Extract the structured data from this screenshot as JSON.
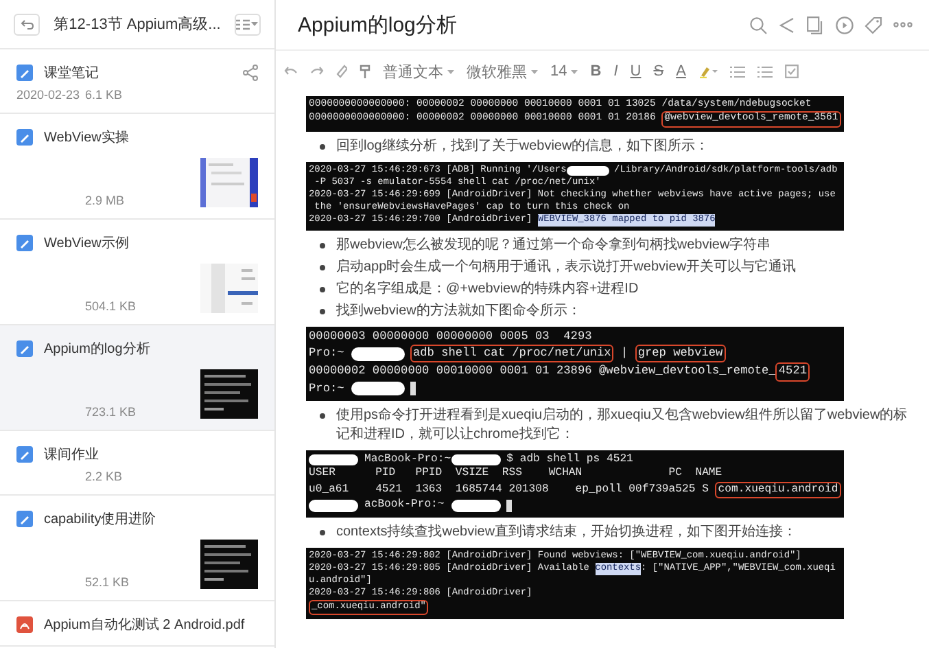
{
  "sidebar": {
    "title": "第12-13节 Appium高级...",
    "notes": [
      {
        "kind": "note",
        "title": "课堂笔记",
        "date": "2020-02-23",
        "size": "6.1 KB",
        "shared": true,
        "selected": false
      },
      {
        "kind": "note",
        "title": "WebView实操",
        "size": "2.9 MB",
        "shared": false,
        "thumbnail": {
          "kind": "light"
        },
        "selected": false
      },
      {
        "kind": "note",
        "title": "WebView示例",
        "size": "504.1 KB",
        "shared": false,
        "thumbnail": {
          "kind": "list"
        },
        "selected": false
      },
      {
        "kind": "note",
        "title": "Appium的log分析",
        "size": "723.1 KB",
        "shared": false,
        "thumbnail": {
          "kind": "dark"
        },
        "selected": true
      },
      {
        "kind": "note",
        "title": "课间作业",
        "size": "2.2 KB",
        "shared": false,
        "selected": false
      },
      {
        "kind": "note",
        "title": "capability使用进阶",
        "size": "52.1 KB",
        "shared": false,
        "thumbnail": {
          "kind": "dark"
        },
        "selected": false
      },
      {
        "kind": "pdf",
        "title": "Appium自动化测试 2 Android.pdf",
        "shared": false,
        "selected": false
      }
    ]
  },
  "editor": {
    "title": "Appium的log分析",
    "toolbar": {
      "style": "普通文本",
      "font": "微软雅黑",
      "size": "14",
      "bold": "B",
      "italic": "I",
      "underline": "U",
      "strike": "S",
      "text_color": "A"
    },
    "blocks": [
      {
        "kind": "terminal",
        "lines": [
          [
            {
              "kind": "text",
              "text": "0000000000000000: 00000002 00000000 00010000 0001 01 13025 /data/system/ndebugsocket"
            }
          ],
          [
            {
              "kind": "text",
              "text": "0000000000000000: 00000002 00000000 00010000 0001 01 20186 "
            },
            {
              "kind": "boxed",
              "text": "@webview_devtools_remote_3561"
            }
          ]
        ]
      },
      {
        "kind": "bullet",
        "text": "回到log继续分析，找到了关于webview的信息，如下图所示："
      },
      {
        "kind": "terminal",
        "lines": [
          [
            {
              "kind": "text",
              "text": "2020-03-27 15:46:29:673 [ADB] Running '/Users"
            },
            {
              "kind": "redacted"
            },
            {
              "kind": "text",
              "text": "/Library/Android/sdk/platform-tools/adb"
            }
          ],
          [
            {
              "kind": "text",
              "text": " -P 5037 -s emulator-5554 shell cat /proc/net/unix'"
            }
          ],
          [
            {
              "kind": "text",
              "text": "2020-03-27 15:46:29:699 [AndroidDriver] Not checking whether webviews have active pages; use"
            }
          ],
          [
            {
              "kind": "text",
              "text": " the 'ensureWebviewsHavePages' cap to turn this check on"
            }
          ],
          [
            {
              "kind": "text",
              "text": "2020-03-27 15:46:29:700 [AndroidDriver] "
            },
            {
              "kind": "selected",
              "text": "WEBVIEW_3876 mapped to pid 3876"
            }
          ]
        ]
      },
      {
        "kind": "bullet",
        "text": "那webview怎么被发现的呢？通过第一个命令拿到句柄找webview字符串"
      },
      {
        "kind": "bullet",
        "text": "启动app时会生成一个句柄用于通讯，表示说打开webview开关可以与它通讯"
      },
      {
        "kind": "bullet",
        "text": "它的名字组成是：@+webview的特殊内容+进程ID"
      },
      {
        "kind": "bullet",
        "text": "找到webview的方法就如下图命令所示："
      },
      {
        "kind": "terminal",
        "lines": [
          [
            {
              "kind": "text",
              "text": "00000003 00000000 00000000 0005 03  4293"
            }
          ],
          [
            {
              "kind": "text",
              "text": "Pro:~ "
            },
            {
              "kind": "redacted"
            },
            {
              "kind": "boxed",
              "text": "adb shell cat /proc/net/unix"
            },
            {
              "kind": "text",
              "text": " | "
            },
            {
              "kind": "boxed",
              "text": "grep webview"
            }
          ],
          [
            {
              "kind": "text",
              "text": "00000002 00000000 00010000 0001 01 23896 @webview_devtools_remote_"
            },
            {
              "kind": "boxed",
              "text": "4521"
            }
          ],
          [
            {
              "kind": "text",
              "text": "Pro:~ "
            },
            {
              "kind": "redacted"
            },
            {
              "kind": "cursor"
            }
          ]
        ]
      },
      {
        "kind": "bullet",
        "text": "使用ps命令打开进程看到是xueqiu启动的，那xueqiu又包含webview组件所以留了webview的标记和进程ID，就可以让chrome找到它："
      },
      {
        "kind": "terminal",
        "lines": [
          [
            {
              "kind": "redacted"
            },
            {
              "kind": "text",
              "text": "MacBook-Pro:~"
            },
            {
              "kind": "redacted"
            },
            {
              "kind": "text",
              "text": "$ adb shell ps 4521"
            }
          ],
          [
            {
              "kind": "text",
              "text": "USER      PID   PPID  VSIZE  RSS    WCHAN             PC  NAME"
            }
          ],
          [
            {
              "kind": "text",
              "text": "u0_a61    4521  1363  1685744 201308    ep_poll 00f739a525 S "
            },
            {
              "kind": "boxed",
              "text": "com.xueqiu.android"
            }
          ],
          [
            {
              "kind": "redacted"
            },
            {
              "kind": "text",
              "text": "acBook-Pro:~ "
            },
            {
              "kind": "redacted"
            },
            {
              "kind": "cursor"
            }
          ]
        ]
      },
      {
        "kind": "bullet",
        "text": "contexts持续查找webview直到请求结束，开始切换进程，如下图开始连接："
      },
      {
        "kind": "terminal",
        "lines": [
          [
            {
              "kind": "text",
              "text": "2020-03-27 15:46:29:802 [AndroidDriver] Found webviews: [\"WEBVIEW_com.xueqiu.android\"]"
            }
          ],
          [
            {
              "kind": "text",
              "text": "2020-03-27 15:46:29:805 [AndroidDriver] Available "
            },
            {
              "kind": "selected",
              "text": "contexts"
            },
            {
              "kind": "text",
              "text": ": [\"NATIVE_APP\",\"WEBVIEW_com.xueqi"
            }
          ],
          [
            {
              "kind": "text",
              "text": "u.android\"]"
            }
          ],
          [
            {
              "kind": "text",
              "text": "2020-03-27 15:46:29:806 [AndroidDriver]"
            }
          ],
          [
            {
              "kind": "boxed",
              "text": "_com.xueqiu.android\""
            }
          ]
        ]
      }
    ]
  }
}
